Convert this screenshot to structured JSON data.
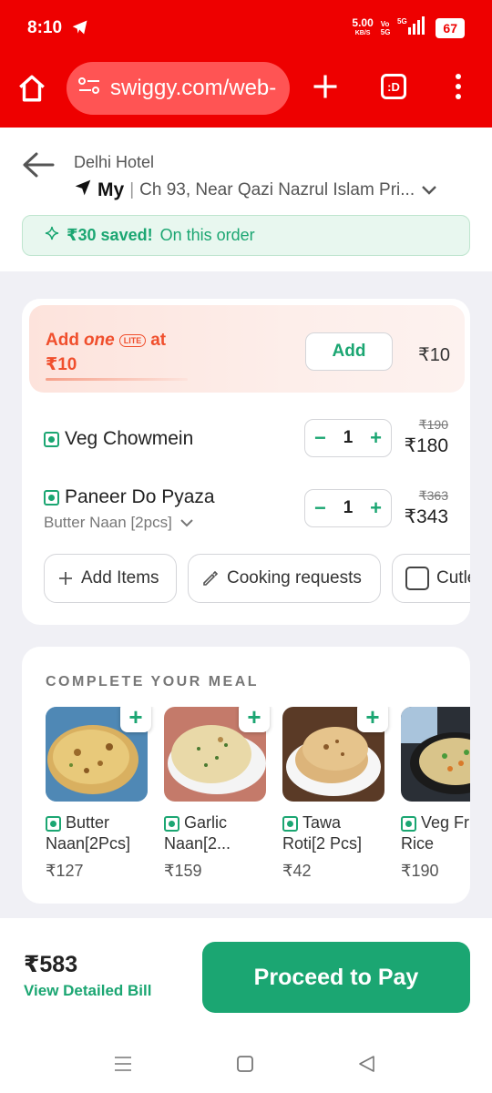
{
  "status": {
    "time": "8:10",
    "speed": "5.00",
    "speed_unit": "KB/S",
    "volte_1": "Vo",
    "volte_2": "5G",
    "net": "5G",
    "battery": "67"
  },
  "browser": {
    "url": "swiggy.com/web-",
    "tabs_label": ":D"
  },
  "header": {
    "restaurant": "Delhi Hotel",
    "address_label": "My",
    "separator": "|",
    "address": "Ch 93, Near Qazi Nazrul Islam Pri...",
    "savings_amount": "₹30 saved!",
    "savings_text": "On this order"
  },
  "one_lite": {
    "add_text": "Add",
    "brand": "one",
    "badge": "LITE",
    "at": "at",
    "price_line": "₹10",
    "button": "Add",
    "price": "₹10"
  },
  "cart": {
    "items": [
      {
        "name": "Veg Chowmein",
        "sub": "",
        "qty": "1",
        "old_price": "₹190",
        "price": "₹180"
      },
      {
        "name": "Paneer Do Pyaza",
        "sub": "Butter Naan [2pcs]",
        "qty": "1",
        "old_price": "₹363",
        "price": "₹343"
      }
    ],
    "minus": "−",
    "plus": "+",
    "chips": {
      "add_items": "Add Items",
      "cooking": "Cooking requests",
      "cutlery": "Cutlery"
    }
  },
  "meal": {
    "title": "COMPLETE YOUR MEAL",
    "add_symbol": "+",
    "items": [
      {
        "name": "Butter Naan[2Pcs]",
        "price": "₹127"
      },
      {
        "name": "Garlic Naan[2...",
        "price": "₹159"
      },
      {
        "name": "Tawa Roti[2 Pcs]",
        "price": "₹42"
      },
      {
        "name": "Veg Fried Rice",
        "price": "₹190"
      }
    ]
  },
  "footer": {
    "total": "₹583",
    "view_bill": "View Detailed Bill",
    "pay": "Proceed to Pay"
  },
  "colors": {
    "brand_red": "#ee0000",
    "swiggy_green": "#1ba672",
    "one_orange": "#f04f2d"
  }
}
